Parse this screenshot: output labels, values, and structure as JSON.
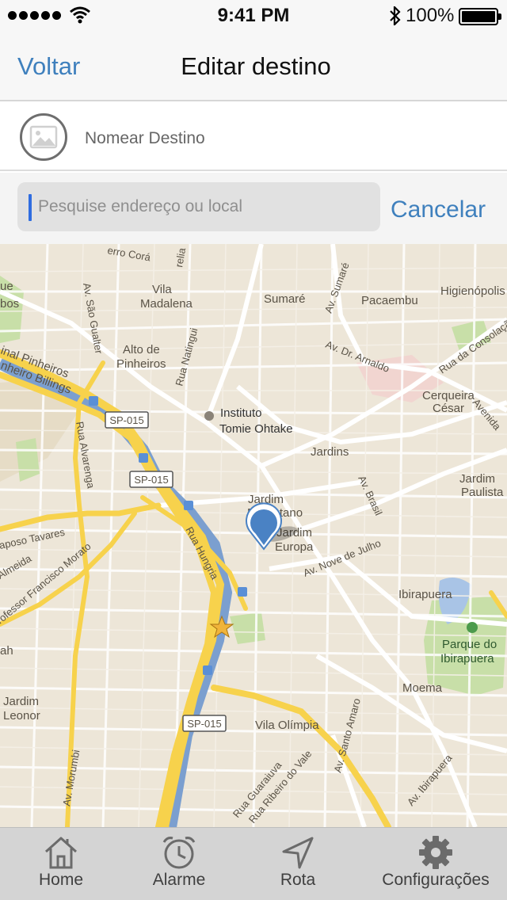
{
  "status_bar": {
    "time": "9:41 PM",
    "battery": "100%"
  },
  "nav": {
    "back_label": "Voltar",
    "title": "Editar destino"
  },
  "destination": {
    "name_placeholder": "Nomear Destino"
  },
  "search": {
    "placeholder": "Pesquise endereço ou local",
    "cancel_label": "Cancelar"
  },
  "map": {
    "labels": {
      "ue": "ue",
      "bos": "bos",
      "vila_madalena_1": "Vila",
      "vila_madalena_2": "Madalena",
      "sumare": "Sumaré",
      "pacaembu": "Pacaembu",
      "higienopolis": "Higienópolis",
      "alto_pinheiros_1": "Alto de",
      "alto_pinheiros_2": "Pinheiros",
      "marg_pinheiros": "inal Pinheiros",
      "pinheiro_billings": "nheiro Billings",
      "instituto_1": "Instituto",
      "instituto_2": "Tomie Ohtake",
      "cerqueira_1": "Cerqueira",
      "cerqueira_2": "César",
      "jardins": "Jardins",
      "jardim_paulista_1": "Jardim",
      "jardim_paulista_2": "Paulista",
      "jardim_paulistano_1": "Jardim",
      "jardim_paulistano_2": "Paulistano",
      "jardim_europa_1": "Jardim",
      "jardim_europa_2": "Europa",
      "ibirapuera": "Ibirapuera",
      "parque_1": "Parque do",
      "parque_2": "Ibirapuera",
      "moema": "Moema",
      "vila_olimpia": "Vila Olímpia",
      "jardim_leonor_1": "Jardim",
      "jardim_leonor_2": "Leonor",
      "sp015": "SP-015",
      "av_sao_gualter": "Av. São Gualter",
      "rua_natingui": "Rua Natingui",
      "av_sumare": "Av. Sumaré",
      "av_dr_arnaldo": "Av. Dr. Arnaldo",
      "rua_da_consolacao": "Rua da Consolação",
      "avenida": "Avenida",
      "av_brasil": "Av. Brasil",
      "av_nove_de_julho": "Av. Nove de Julho",
      "rua_hungria": "Rua Hungria",
      "av_alvarenga": "Rua Alvarenga",
      "raposo_tavares": "aposo Tavares",
      "almeida": "Almeida",
      "prof_francisco_morato": "rofessor Francisco Morato",
      "av_morumbi": "Av. Morumbi",
      "rua_guaraiuva": "Rua Guaraiuva",
      "rua_ribeiro_do_vale": "Rua Ribeiro do Vale",
      "av_santo_amaro": "Av. Santo Amaro",
      "av_ibirapuera": "Av. Ibirapuera",
      "rua_cora": "erro Corá",
      "relia": "relia",
      "ah": "ah"
    }
  },
  "tabs": [
    {
      "label": "Home",
      "icon": "home-icon"
    },
    {
      "label": "Alarme",
      "icon": "alarm-clock-icon"
    },
    {
      "label": "Rota",
      "icon": "navigation-arrow-icon"
    },
    {
      "label": "Configurações",
      "icon": "gear-icon"
    }
  ],
  "colors": {
    "accent": "#3f80bd",
    "map_background": "#ede6d8",
    "highway": "#f7d24c",
    "river": "#7b9fcf",
    "park": "#c8dfa8",
    "pin": "#4a82c4"
  }
}
